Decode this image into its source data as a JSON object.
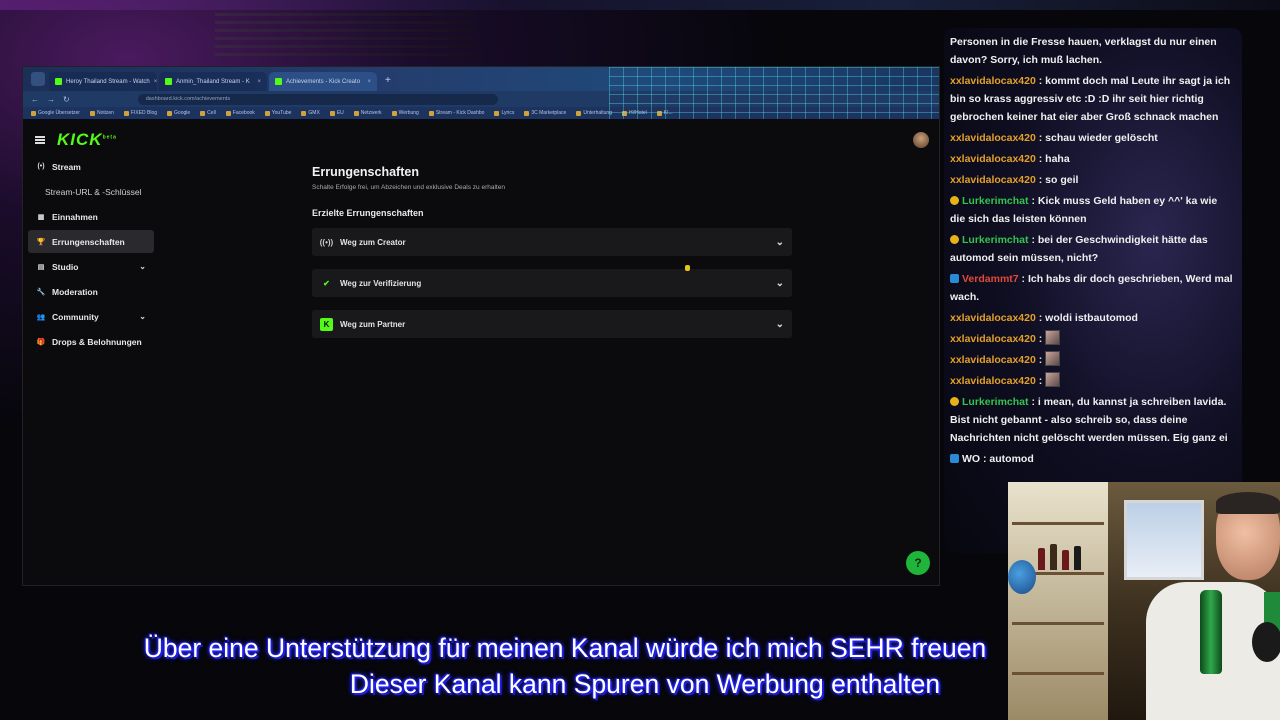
{
  "browser": {
    "tabs": [
      {
        "label": "Heroy Thailand Stream - Watch"
      },
      {
        "label": "Anmin_Thailand Stream - K"
      },
      {
        "label": "Achievements - Kick Creato"
      }
    ],
    "new_tab": "+",
    "url": "dashboard.kick.com/achievements",
    "bookmarks": [
      "Google Übersetzer",
      "Notizen",
      "FIXED Blog",
      "Google",
      "Cell",
      "Facebook",
      "YouTube",
      "GMX",
      "EU",
      "Netzwerk",
      "Werbung",
      "Stream - Kick Dashbo",
      "Lyrics",
      "3C Marketplace",
      "Unterhaltung",
      "Hi!Hotel",
      "KI..."
    ]
  },
  "kick": {
    "logo": "KICK",
    "logo_sup": "beta",
    "sidebar": [
      {
        "label": "Stream",
        "icon": "broadcast-icon",
        "glyph": "(•)"
      },
      {
        "label": "Stream-URL & -Schlüssel",
        "sub": true
      },
      {
        "label": "Einnahmen",
        "icon": "earnings-icon",
        "glyph": "▦"
      },
      {
        "label": "Errungenschaften",
        "icon": "trophy-icon",
        "glyph": "🏆"
      },
      {
        "label": "Studio",
        "icon": "studio-icon",
        "glyph": "▤",
        "chevron": "⌄"
      },
      {
        "label": "Moderation",
        "icon": "wrench-icon",
        "glyph": "🔧"
      },
      {
        "label": "Community",
        "icon": "community-icon",
        "glyph": "👥",
        "chevron": "⌄"
      },
      {
        "label": "Drops & Belohnungen",
        "icon": "gift-icon",
        "glyph": "🎁"
      }
    ],
    "main": {
      "title": "Errungenschaften",
      "subtitle": "Schalte Erfolge frei, um Abzeichen und exklusive Deals zu erhalten",
      "section": "Erzielte Errungenschaften",
      "achievements": [
        {
          "label": "Weg zum Creator",
          "glyph": "((•))",
          "color": "#cfcfcf"
        },
        {
          "label": "Weg zur Verifizierung",
          "glyph": "✔",
          "color": "#53fc18"
        },
        {
          "label": "Weg zum Partner",
          "glyph": "K",
          "color": "#53fc18"
        }
      ]
    },
    "help_glyph": "?"
  },
  "chat": {
    "messages": [
      {
        "user": "",
        "text": "Personen in die Fresse hauen, verklagst du nur einen davon? Sorry, ich muß lachen."
      },
      {
        "user": "xxlavidalocax420",
        "text": "kommt doch mal Leute ihr sagt ja ich bin so krass aggressiv etc :D :D ihr seit hier richtig gebrochen keiner hat eier aber Groß schnack machen"
      },
      {
        "user": "xxlavidalocax420",
        "text": "schau wieder gelöscht"
      },
      {
        "user": "xxlavidalocax420",
        "text": "haha"
      },
      {
        "user": "xxlavidalocax420",
        "text": "so geil"
      },
      {
        "user": "Lurkerimchat",
        "text": "Kick muss Geld haben ey ^^' ka wie die sich das leisten können",
        "style": "green",
        "badge": true
      },
      {
        "user": "Lurkerimchat",
        "text": "bei der Geschwindigkeit hätte das automod sein müssen, nicht?",
        "style": "green",
        "badge": true
      },
      {
        "user": "Verdammt7",
        "text": "Ich habs dir doch geschrieben, Werd mal wach.",
        "style": "red",
        "badge": true
      },
      {
        "user": "xxlavidalocax420",
        "text": "woldi istbautomod"
      },
      {
        "user": "xxlavidalocax420",
        "text": "",
        "emote": true
      },
      {
        "user": "xxlavidalocax420",
        "text": "",
        "emote": true
      },
      {
        "user": "xxlavidalocax420",
        "text": "",
        "emote": true
      },
      {
        "user": "Lurkerimchat",
        "text": "i mean, du kannst ja schreiben lavida. Bist nicht gebannt - also schreib so, dass deine Nachrichten nicht gelöscht werden müssen. Eig ganz ei",
        "style": "green",
        "badge": true
      },
      {
        "user": "WO",
        "text": "automod",
        "style": "plain",
        "badge": true
      }
    ]
  },
  "subtitles": {
    "line1": "Über eine Unterstützung für meinen Kanal würde ich mich SEHR freuen",
    "line2": "Dieser Kanal kann Spuren von Werbung enthalten"
  }
}
